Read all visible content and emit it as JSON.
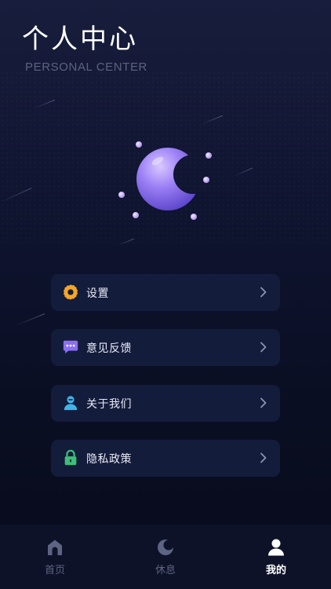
{
  "header": {
    "title": "个人中心",
    "subtitle": "PERSONAL CENTER"
  },
  "menu": [
    {
      "label": "设置",
      "icon": "gear-icon",
      "color": "#f5a623"
    },
    {
      "label": "意见反馈",
      "icon": "message-icon",
      "color": "#8b6ff0"
    },
    {
      "label": "关于我们",
      "icon": "user-icon",
      "color": "#3fb5e8"
    },
    {
      "label": "隐私政策",
      "icon": "lock-icon",
      "color": "#3dbf77"
    }
  ],
  "tabbar": {
    "tabs": [
      {
        "label": "首页",
        "icon": "home-icon",
        "active": false
      },
      {
        "label": "休息",
        "icon": "moon-icon",
        "active": false
      },
      {
        "label": "我的",
        "icon": "person-icon",
        "active": true
      }
    ]
  },
  "colors": {
    "background": "#0f1430",
    "card": "#141c3c",
    "moon": "#8a74f0",
    "inactive_tab": "#5d6382",
    "active_tab": "#ffffff"
  }
}
